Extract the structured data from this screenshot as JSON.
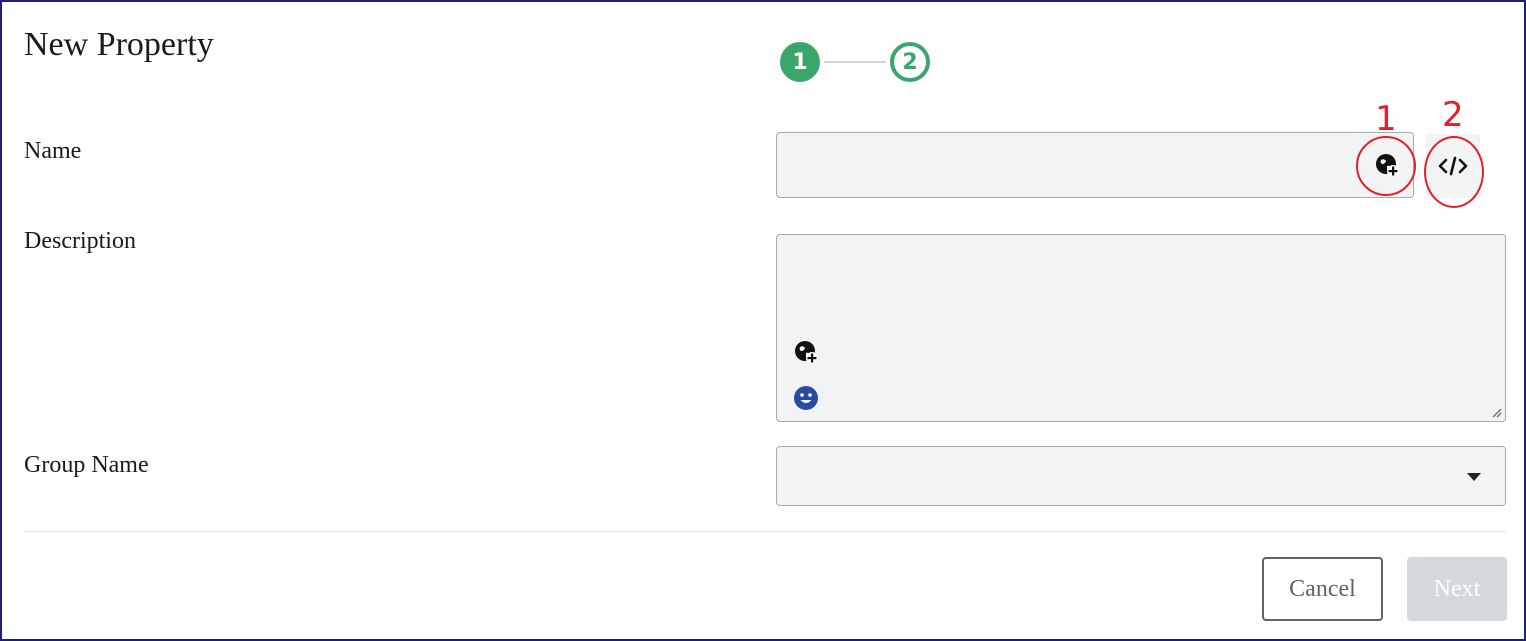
{
  "dialog": {
    "title": "New Property",
    "steps": [
      {
        "label": "1",
        "state": "current"
      },
      {
        "label": "2",
        "state": "pending"
      }
    ]
  },
  "form": {
    "name": {
      "label": "Name",
      "value": ""
    },
    "description": {
      "label": "Description",
      "value": ""
    },
    "group_name": {
      "label": "Group Name",
      "selected": ""
    }
  },
  "annotations": {
    "marker_1": "1",
    "marker_2": "2"
  },
  "footer": {
    "cancel_label": "Cancel",
    "next_label": "Next"
  },
  "icons": {
    "translate": "globe-plus-icon",
    "code": "code-icon",
    "emoji": "emoji-icon",
    "dropdown": "caret-down-icon"
  },
  "colors": {
    "accent_green": "#3aa66b",
    "annotation_red": "#e3202a",
    "field_bg": "#f2f3f5",
    "disabled_button": "#d4d7dc",
    "emoji_blue": "#2b4c9e"
  }
}
